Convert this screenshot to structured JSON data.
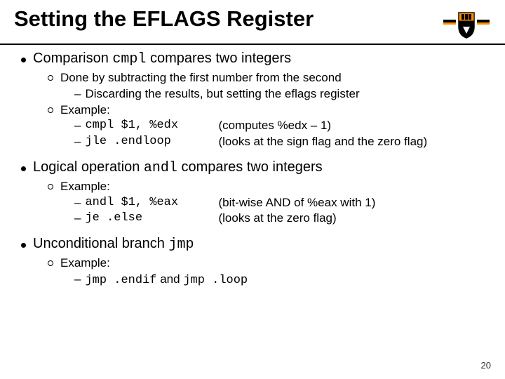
{
  "title": "Setting the EFLAGS Register",
  "b1": {
    "text_a": "Comparison ",
    "code": "cmpl",
    "text_b": " compares two integers",
    "sub1": "Done by subtracting the first number from the second",
    "sub1a": "Discarding the results, but setting the eflags register",
    "sub2": "Example:",
    "ex1_code": "cmpl $1, %edx",
    "ex1_desc": "(computes %edx – 1)",
    "ex2_code": "jle .endloop",
    "ex2_desc": "(looks at the sign flag and the zero flag)"
  },
  "b2": {
    "text_a": "Logical operation ",
    "code": "andl",
    "text_b": " compares two integers",
    "sub1": "Example:",
    "ex1_code": "andl $1, %eax",
    "ex1_desc": "(bit-wise AND of %eax with 1)",
    "ex2_code": "je .else",
    "ex2_desc": "(looks at the zero flag)"
  },
  "b3": {
    "text_a": "Unconditional branch ",
    "code": "jmp",
    "sub1": "Example:",
    "ex1_code1": "jmp .endif",
    "ex1_mid": " and ",
    "ex1_code2": "jmp .loop"
  },
  "page": "20"
}
